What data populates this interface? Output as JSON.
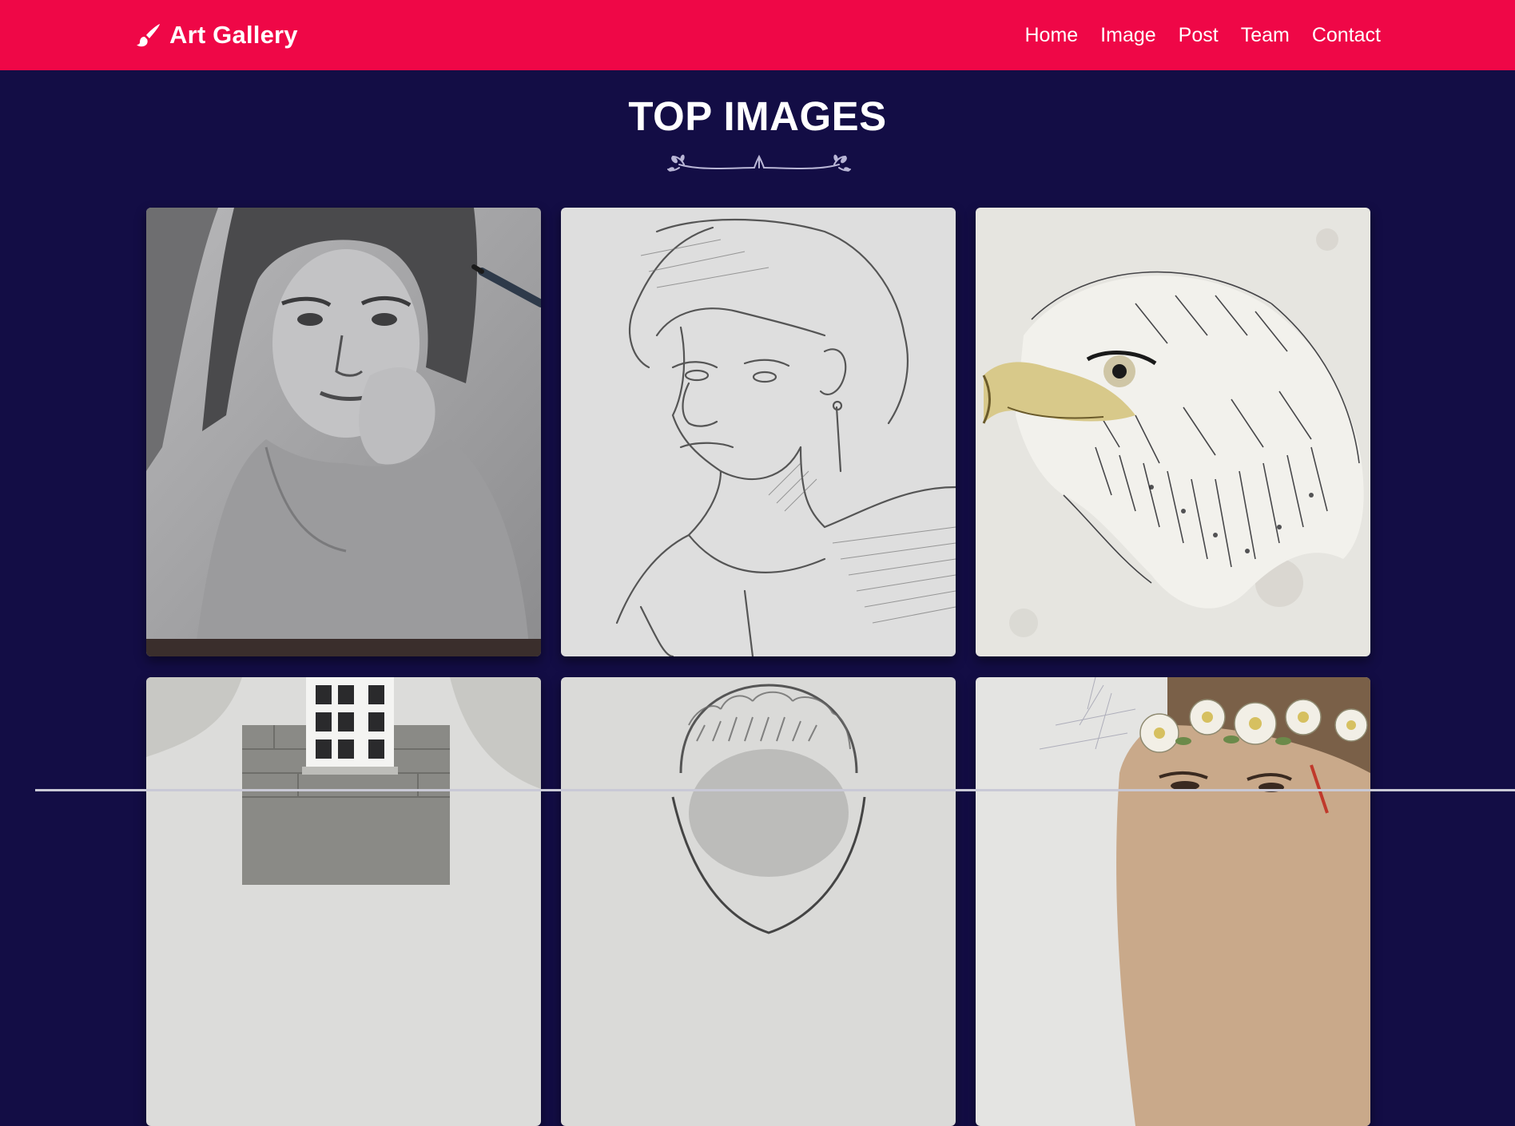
{
  "navbar": {
    "brand_icon": "paintbrush-icon",
    "brand": "Art Gallery",
    "links": [
      "Home",
      "Image",
      "Post",
      "Team",
      "Contact"
    ],
    "background_color": "#ef0747"
  },
  "section": {
    "title": "TOP IMAGES",
    "divider_icon": "floral-divider-icon"
  },
  "gallery": {
    "images": [
      {
        "subject": "pencil portrait of a woman resting chin on hand"
      },
      {
        "subject": "pencil sketch of a young man with earring"
      },
      {
        "subject": "ink painting of an eagle head"
      },
      {
        "subject": "watercolor window in a stone wall"
      },
      {
        "subject": "pencil sketch of a head"
      },
      {
        "subject": "woman with a flower crown"
      }
    ]
  },
  "colors": {
    "page_background": "#130d45",
    "accent": "#ef0747",
    "text": "#ffffff"
  }
}
